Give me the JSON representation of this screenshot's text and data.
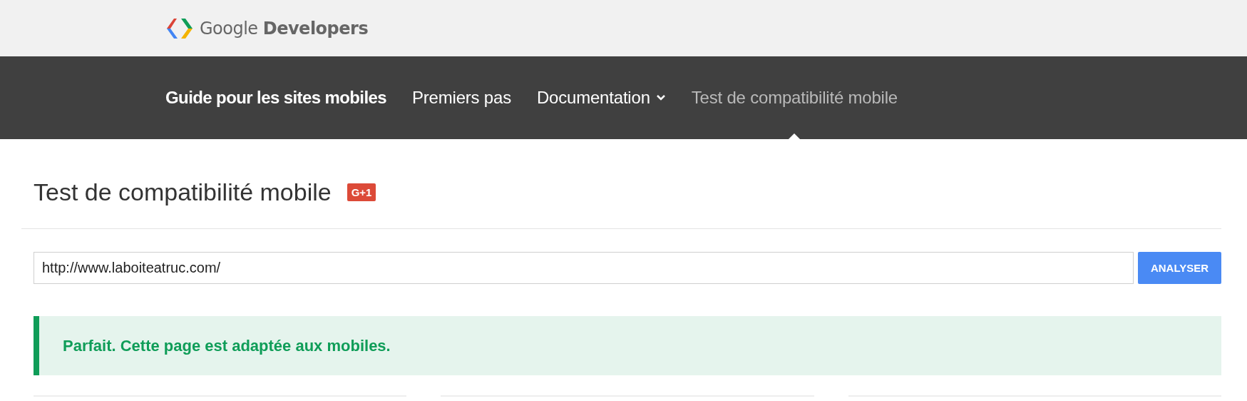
{
  "header": {
    "logo_text": "Google **Developers**"
  },
  "nav": {
    "items": [
      {
        "label": "Guide pour les sites mobiles",
        "kind": "title",
        "selected": false,
        "dropdown": false
      },
      {
        "label": "Premiers pas",
        "kind": "link",
        "selected": false,
        "dropdown": false
      },
      {
        "label": "Documentation",
        "kind": "link",
        "selected": false,
        "dropdown": true
      },
      {
        "label": "Test de compatibilité mobile",
        "kind": "link",
        "selected": true,
        "dropdown": false
      }
    ]
  },
  "page": {
    "title": "Test de compatibilité mobile",
    "plus_button": "G+1"
  },
  "form": {
    "url_value": "http://www.laboiteatruc.com/",
    "submit": "ANALYSER"
  },
  "result": {
    "message": "Parfait. Cette page est adaptée aux mobiles."
  }
}
